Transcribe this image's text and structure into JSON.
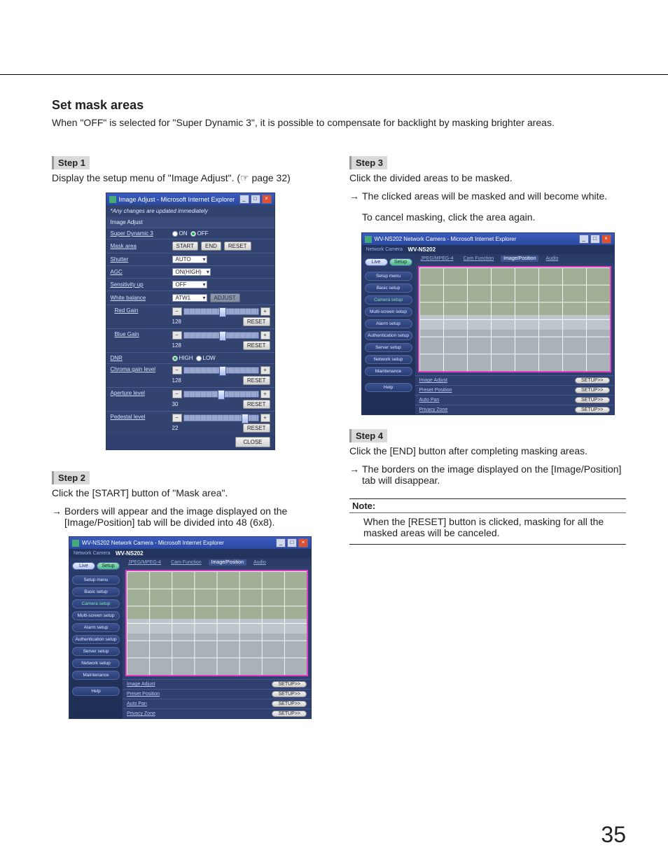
{
  "page_number": "35",
  "section_title": "Set mask areas",
  "intro": "When \"OFF\" is selected for \"Super Dynamic 3\", it is possible to compensate for backlight by masking brighter areas.",
  "step1": {
    "label": "Step 1",
    "text": "Display the setup menu of \"Image Adjust\". (☞ page 32)"
  },
  "step2": {
    "label": "Step 2",
    "text": "Click the [START] button of \"Mask area\".",
    "bullet": "Borders will appear and the image displayed on the [Image/Position] tab will be divided into 48 (6x8)."
  },
  "step3": {
    "label": "Step 3",
    "text": "Click the divided areas to be masked.",
    "bullet1": "The clicked areas will be masked and will become white.",
    "bullet2": "To cancel masking, click the area again."
  },
  "step4": {
    "label": "Step 4",
    "text": "Click the [END] button after completing masking areas.",
    "bullet": "The borders on the image displayed on the [Image/Position] tab will disappear."
  },
  "note": {
    "head": "Note:",
    "body": "When the [RESET] button is clicked, masking for all the masked areas will be canceled."
  },
  "dialog": {
    "title": "Image Adjust - Microsoft Internet Explorer",
    "note": "*Any changes are updated immediately",
    "header": "Image Adjust",
    "sd3": {
      "label": "Super Dynamic 3",
      "on": "ON",
      "off": "OFF"
    },
    "mask": {
      "label": "Mask area",
      "start": "START",
      "end": "END",
      "reset": "RESET"
    },
    "shutter": {
      "label": "Shutter",
      "value": "AUTO"
    },
    "agc": {
      "label": "AGC",
      "value": "ON(HIGH)"
    },
    "sens": {
      "label": "Sensitivity up",
      "value": "OFF"
    },
    "wb": {
      "label": "White balance",
      "value": "ATW1",
      "adjust": "ADJUST"
    },
    "red": {
      "label": "Red Gain",
      "value": "128",
      "reset": "RESET"
    },
    "blue": {
      "label": "Blue Gain",
      "value": "128",
      "reset": "RESET"
    },
    "dnr": {
      "label": "DNR",
      "high": "HIGH",
      "low": "LOW"
    },
    "chroma": {
      "label": "Chroma gain level",
      "value": "128",
      "reset": "RESET"
    },
    "aperture": {
      "label": "Aperture level",
      "value": "30",
      "reset": "RESET"
    },
    "pedestal": {
      "label": "Pedestal level",
      "value": "22",
      "reset": "RESET"
    },
    "close": "CLOSE"
  },
  "camui": {
    "title": "WV-NS202 Network Camera - Microsoft Internet Explorer",
    "brand": "Network Camera",
    "model": "WV-NS202",
    "live": "Live",
    "setup": "Setup",
    "side": {
      "menu": "Setup menu",
      "basic": "Basic setup",
      "camera": "Camera setup",
      "multi": "Multi-screen setup",
      "alarm": "Alarm setup",
      "auth": "Authentication setup",
      "server": "Server setup",
      "network": "Network setup",
      "maint": "Maintenance",
      "help": "Help"
    },
    "tabs": {
      "t1": "JPEG/MPEG-4",
      "t2": "Cam Function",
      "t3": "Image/Position",
      "t4": "Audio"
    },
    "links": {
      "l1": "Image Adjust",
      "l2": "Preset Position",
      "l3": "Auto Pan",
      "l4": "Privacy Zone"
    },
    "setup_btn": "SETUP>>"
  }
}
